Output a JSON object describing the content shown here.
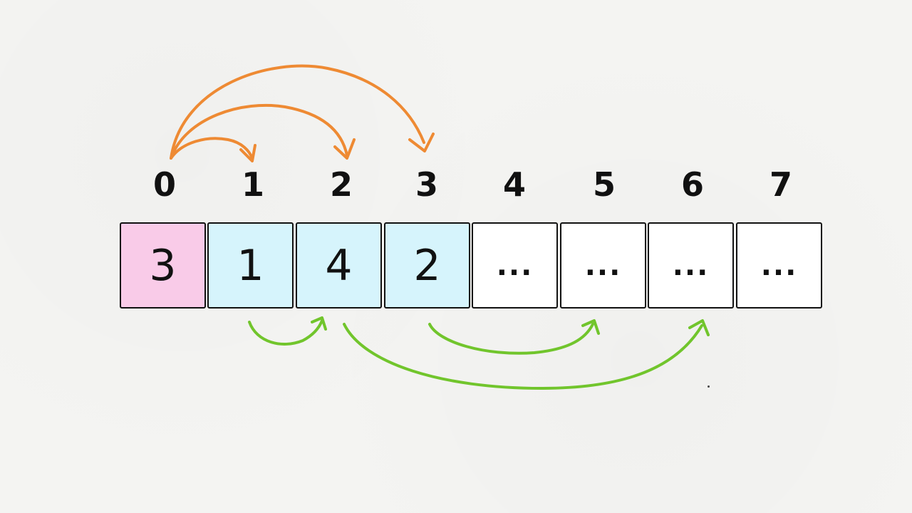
{
  "colors": {
    "start_cell": "#f9cbe8",
    "reachable_cell": "#d6f4fc",
    "empty_cell": "#ffffff",
    "orange_arrows": "#ee8a33",
    "green_arrows": "#71c52c"
  },
  "indices": [
    "0",
    "1",
    "2",
    "3",
    "4",
    "5",
    "6",
    "7"
  ],
  "cells": [
    {
      "value": "3",
      "state": "start"
    },
    {
      "value": "1",
      "state": "reachable"
    },
    {
      "value": "4",
      "state": "reachable"
    },
    {
      "value": "2",
      "state": "reachable"
    },
    {
      "value": "...",
      "state": "empty"
    },
    {
      "value": "...",
      "state": "empty"
    },
    {
      "value": "...",
      "state": "empty"
    },
    {
      "value": "...",
      "state": "empty"
    }
  ],
  "orange_jumps": [
    {
      "from": "0",
      "to": "1"
    },
    {
      "from": "0",
      "to": "2"
    },
    {
      "from": "0",
      "to": "3"
    }
  ],
  "green_jumps": [
    {
      "from": "1",
      "to": "2"
    },
    {
      "from": "2",
      "to": "6"
    },
    {
      "from": "3",
      "to": "5"
    }
  ]
}
